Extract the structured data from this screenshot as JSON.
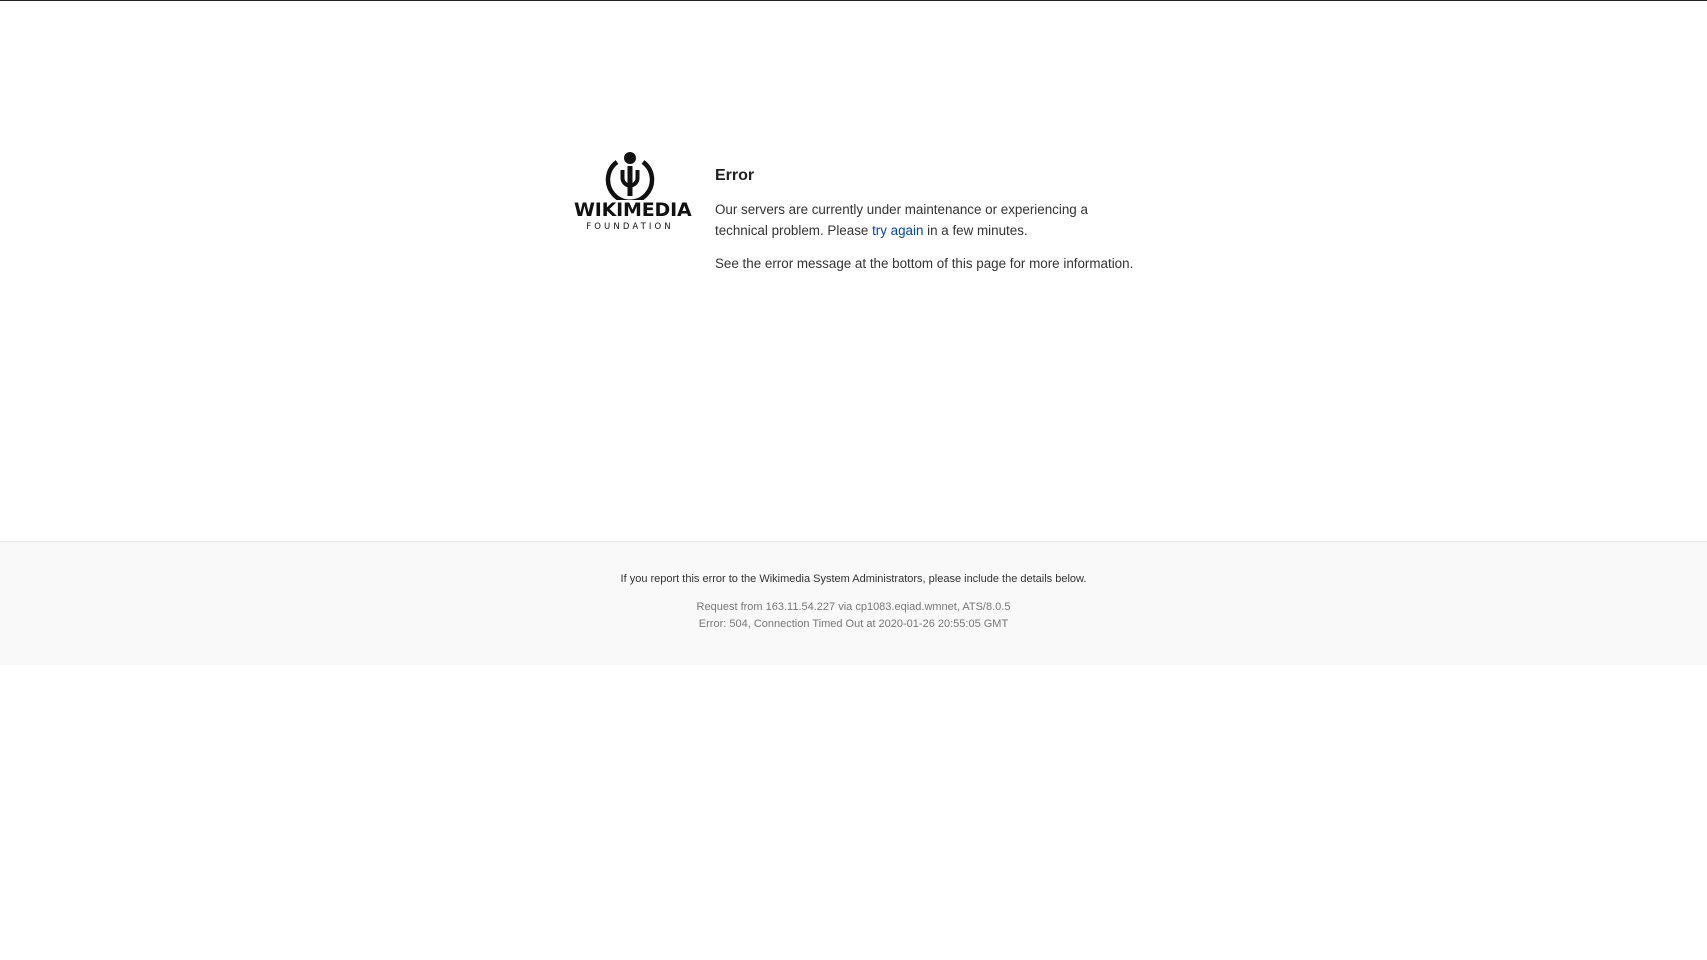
{
  "logo": {
    "icon": "wikimedia-logo-icon",
    "wordmark": "WIKIMEDIA",
    "subtitle": "FOUNDATION"
  },
  "error": {
    "title": "Error",
    "message_part1": "Our servers are currently under maintenance or experiencing a technical problem. Please ",
    "retry_link": "try again",
    "message_part2": " in a few minutes.",
    "see_more": "See the error message at the bottom of this page for more information."
  },
  "footer": {
    "report_note": "If you report this error to the Wikimedia System Administrators, please include the details below.",
    "request_line": "Request from 163.11.54.227 via cp1083.eqiad.wmnet, ATS/8.0.5",
    "error_line": "Error: 504, Connection Timed Out at 2020-01-26 20:55:05 GMT"
  },
  "colors": {
    "link": "#0645ad",
    "footer_bg": "#f9f9f9",
    "text": "#333333"
  }
}
